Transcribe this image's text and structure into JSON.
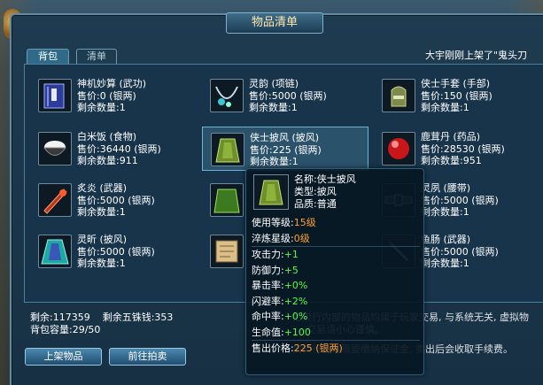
{
  "window": {
    "title": "物品清单"
  },
  "tabs": [
    {
      "label": "背包"
    },
    {
      "label": "清单"
    }
  ],
  "marquee": "大宇刚刚上架了\"鬼头刀",
  "items": [
    {
      "name": "神机妙算 (武功)",
      "price": "售价:0 (银两)",
      "qty": "剩余数量:1",
      "icon": "book-icon"
    },
    {
      "name": "灵韵 (项链)",
      "price": "售价:5000 (银两)",
      "qty": "剩余数量:1",
      "icon": "necklace-icon"
    },
    {
      "name": "侠士手套 (手部)",
      "price": "售价:150 (银两)",
      "qty": "剩余数量:1",
      "icon": "glove-icon"
    },
    {
      "name": "白米饭 (食物)",
      "price": "售价:36440 (银两)",
      "qty": "剩余数量:911",
      "icon": "rice-bowl-icon"
    },
    {
      "name": "侠士披风 (披风)",
      "price": "售价:225 (银两)",
      "qty": "剩余数量:1",
      "icon": "cape-icon"
    },
    {
      "name": "鹿茸丹 (药品)",
      "price": "售价:28530 (银两)",
      "qty": "剩余数量:951",
      "icon": "pill-icon"
    },
    {
      "name": "炙炎 (武器)",
      "price": "售价:5000 (银两)",
      "qty": "剩余数量:1",
      "icon": "weapon-icon"
    },
    {
      "name": "",
      "price": "",
      "qty": "",
      "icon": "green-cape-icon"
    },
    {
      "name": "灵夙 (腰带)",
      "price": "售价:5000 (银两)",
      "qty": "剩余数量:1",
      "icon": "belt-icon"
    },
    {
      "name": "灵昕 (披风)",
      "price": "售价:5000 (银两)",
      "qty": "剩余数量:1",
      "icon": "cloak-icon"
    },
    {
      "name": "",
      "price": "",
      "qty": "",
      "icon": "scroll-icon"
    },
    {
      "name": "鱼肠 (武器)",
      "price": "售价:5000 (银两)",
      "qty": "剩余数量:1",
      "icon": "dagger-icon"
    }
  ],
  "footer": {
    "remaining": "剩余:117359",
    "coins": "剩余五铢钱:353",
    "capacity": "背包容量:29/50",
    "notice1": "拍卖行内部的物品均属于玩家交易, 与系统无关, 虚拟物",
    "notice2": "交易请小心谨慎。",
    "notice3": "拍卖行上架需要缴纳保证金, 卖出后会收取手续费。"
  },
  "buttons": {
    "list": "上架物品",
    "auction": "前往拍卖"
  },
  "tooltip": {
    "name": "名称:侠士披风",
    "type": "类型:披风",
    "quality": "品质:普通",
    "rows": [
      {
        "label": "使用等级:",
        "value": "15级",
        "tone": "orange"
      },
      {
        "label": "淬炼星级:",
        "value": "0级",
        "tone": "orange"
      },
      {
        "label": "攻击力:",
        "value": "+1",
        "tone": "green"
      },
      {
        "label": "防御力:",
        "value": "+5",
        "tone": "green"
      },
      {
        "label": "暴击率:",
        "value": "+0%",
        "tone": "green"
      },
      {
        "label": "闪避率:",
        "value": "+2%",
        "tone": "green"
      },
      {
        "label": "命中率:",
        "value": "+0%",
        "tone": "green"
      },
      {
        "label": "生命值:",
        "value": "+100",
        "tone": "green"
      },
      {
        "label": "售出价格:",
        "value": "225 (银两)",
        "tone": "orange"
      }
    ]
  },
  "colors": {
    "orange": "#ff9f2e",
    "green": "#4dfc4d"
  }
}
